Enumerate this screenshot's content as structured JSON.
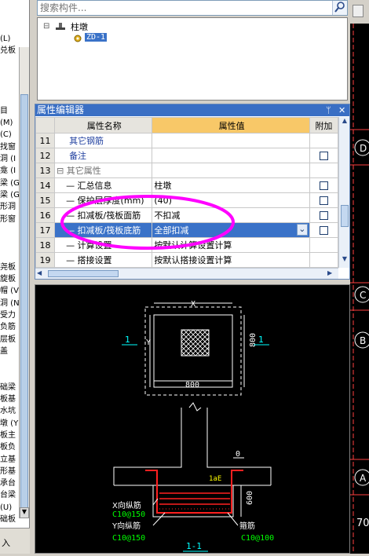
{
  "left_panel": {
    "items": [
      "(L)",
      "兑板",
      "",
      "",
      "",
      "",
      "目",
      "(M)",
      "(C)",
      "找窗",
      "洞 (I",
      "龛 (I",
      "梁 (G",
      "梁 (G",
      "形洞",
      "形窗",
      "",
      "",
      "",
      "尧板",
      "旋板",
      "帽 (V",
      "洞 (N",
      "受力",
      "负筋",
      "层板",
      "盖",
      "",
      "",
      "础梁",
      "板基",
      "水坑",
      "墩 (Y",
      "板主",
      "板负",
      "立基",
      "形基",
      "承台",
      "台梁",
      "(U)",
      "础板"
    ],
    "bottom_label": "入"
  },
  "search": {
    "placeholder": "搜索构件..."
  },
  "tree": {
    "root_label": "柱墩",
    "child_label": "ZD-1",
    "expand_symbol": "⊟"
  },
  "property_editor": {
    "title": "属性编辑器",
    "pin": "ᛘ",
    "close": "✕",
    "headers": {
      "num": "",
      "name": "属性名称",
      "value": "属性值",
      "extra": "附加"
    },
    "rows": [
      {
        "num": "11",
        "name": "其它钢筋",
        "value": "",
        "has_cb": false,
        "style": "blue"
      },
      {
        "num": "12",
        "name": "备注",
        "value": "",
        "has_cb": true,
        "style": "blue"
      },
      {
        "num": "13",
        "name": "⊟ 其它属性",
        "value": "",
        "has_cb": false,
        "style": "gray"
      },
      {
        "num": "14",
        "name": "— 汇总信息",
        "value": "柱墩",
        "has_cb": true,
        "style": ""
      },
      {
        "num": "15",
        "name": "— 保护层厚度(mm)",
        "value": "(40)",
        "has_cb": true,
        "style": ""
      },
      {
        "num": "16",
        "name": "— 扣减板/筏板面筋",
        "value": "不扣减",
        "has_cb": true,
        "style": ""
      },
      {
        "num": "17",
        "name": "— 扣减板/筏板底筋",
        "value": "全部扣减",
        "has_cb": true,
        "style": "selected"
      },
      {
        "num": "18",
        "name": "— 计算设置",
        "value": "按默认计算设置计算",
        "has_cb": false,
        "style": ""
      },
      {
        "num": "19",
        "name": "— 搭接设置",
        "value": "按默认搭接设置计算",
        "has_cb": false,
        "style": ""
      }
    ]
  },
  "cad": {
    "x_label": "X",
    "y_label": "Y",
    "dim_800_v": "800",
    "dim_800_h": "800",
    "sec_left": "1",
    "sec_right": "1",
    "dim_0": "0",
    "lae": "1aE",
    "dim_600": "600",
    "x_bar_label": "X向纵筋",
    "x_bar_value": "C10@150",
    "y_bar_label": "Y向纵筋",
    "y_bar_value": "C10@150",
    "stirrup_label": "箍筋",
    "stirrup_value": "C10@100",
    "section_title": "1-1"
  },
  "right_axis": {
    "labels": [
      "D",
      "C",
      "B",
      "A"
    ],
    "number": "70"
  },
  "colors": {
    "accent": "#3a6fc4",
    "header_value": "#f8c868",
    "annot": "#ff00ff"
  }
}
